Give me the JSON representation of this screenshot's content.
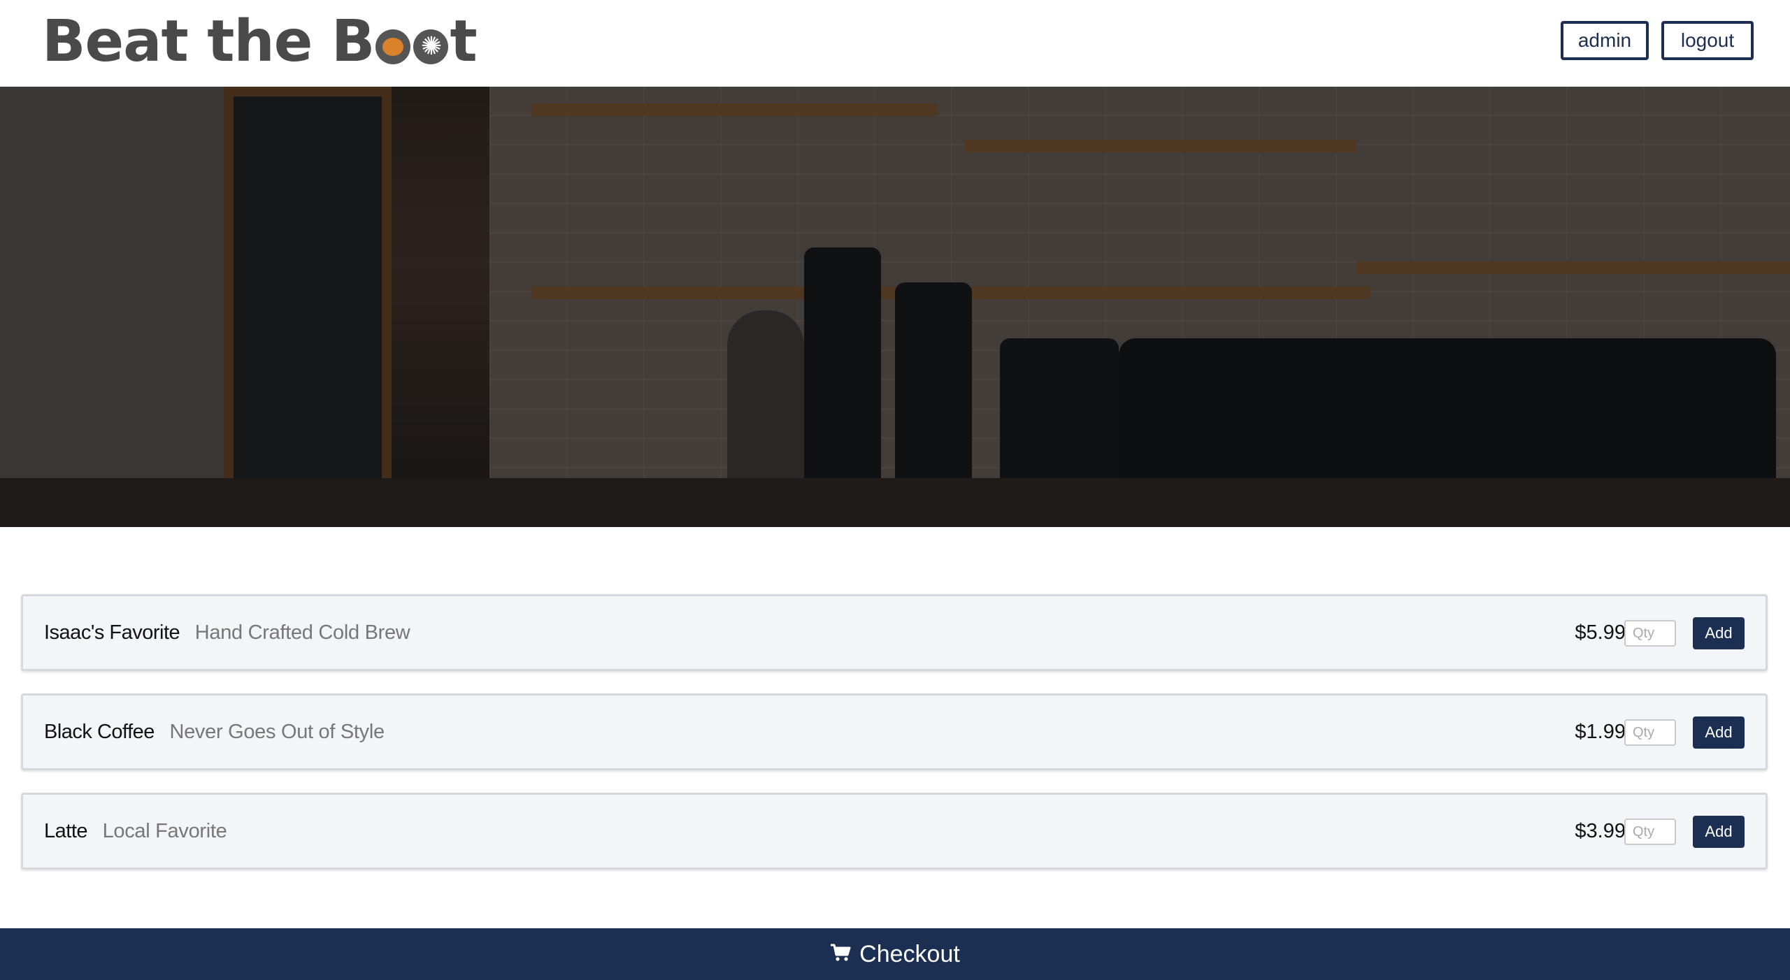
{
  "header": {
    "logo_text_prefix": "Beat the B",
    "logo_text_suffix": "t",
    "admin_label": "admin",
    "logout_label": "logout"
  },
  "products": [
    {
      "name": "Isaac's Favorite",
      "description": "Hand Crafted Cold Brew",
      "price": "$5.99",
      "qty_placeholder": "Qty",
      "add_label": "Add"
    },
    {
      "name": "Black Coffee",
      "description": "Never Goes Out of Style",
      "price": "$1.99",
      "qty_placeholder": "Qty",
      "add_label": "Add"
    },
    {
      "name": "Latte",
      "description": "Local Favorite",
      "price": "$3.99",
      "qty_placeholder": "Qty",
      "add_label": "Add"
    }
  ],
  "checkout": {
    "label": "Checkout",
    "icon": "shopping-cart-icon"
  },
  "colors": {
    "brand_navy": "#1b2f52",
    "logo_gray": "#4a4a4a",
    "logo_accent_orange": "#d9822b"
  }
}
